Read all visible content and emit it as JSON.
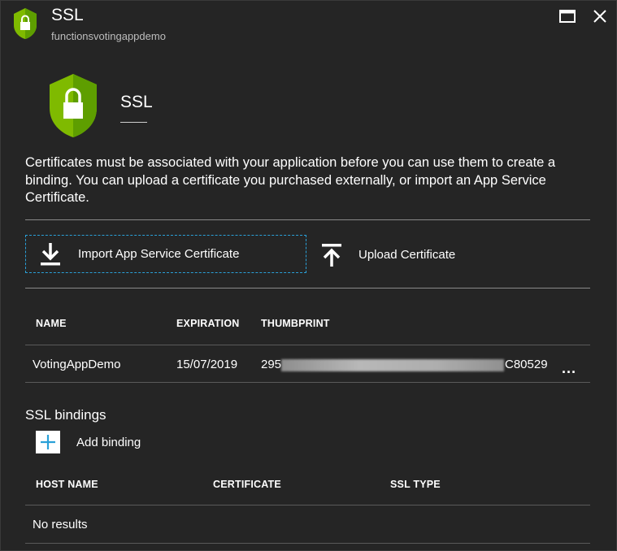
{
  "titlebar": {
    "title": "SSL",
    "subtitle": "functionsvotingappdemo"
  },
  "hero": {
    "title": "SSL"
  },
  "description": "Certificates must be associated with your application before you can use them to create a binding. You can upload a certificate you purchased externally, or import an App Service Certificate.",
  "commands": {
    "import_label": "Import App Service Certificate",
    "upload_label": "Upload Certificate"
  },
  "certificates": {
    "headers": [
      "NAME",
      "EXPIRATION",
      "THUMBPRINT"
    ],
    "rows": [
      {
        "name": "VotingAppDemo",
        "expiration": "15/07/2019",
        "thumb_start": "295",
        "thumb_end": "C80529",
        "more": "..."
      }
    ]
  },
  "bindings": {
    "title": "SSL bindings",
    "add_label": "Add binding",
    "headers": [
      "HOST NAME",
      "CERTIFICATE",
      "SSL TYPE"
    ],
    "empty": "No results"
  },
  "colors": {
    "background": "#252525",
    "shield_green": "#7fba00",
    "accent_blue": "#2aa0d8"
  },
  "icons": {
    "shield": "shield-lock-icon",
    "maximize": "maximize-icon",
    "close": "close-icon",
    "import": "download-arrow-icon",
    "upload": "upload-arrow-icon",
    "add": "plus-icon",
    "more": "ellipsis-icon"
  }
}
